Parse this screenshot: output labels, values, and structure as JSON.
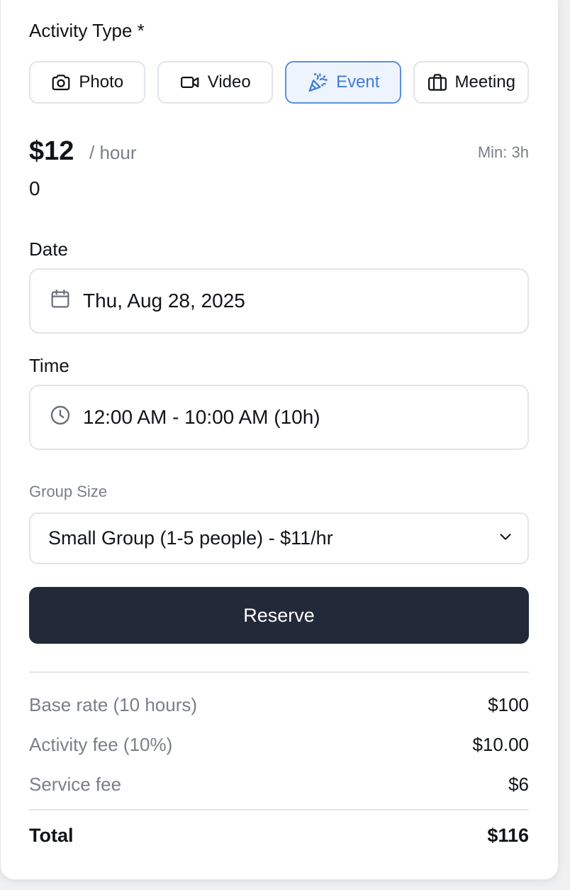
{
  "activity": {
    "label": "Activity Type *",
    "options": [
      {
        "label": "Photo",
        "icon": "camera-icon",
        "selected": false
      },
      {
        "label": "Video",
        "icon": "video-icon",
        "selected": false
      },
      {
        "label": "Event",
        "icon": "party-popper-icon",
        "selected": true
      },
      {
        "label": "Meeting",
        "icon": "briefcase-icon",
        "selected": false
      }
    ],
    "selected_color": "#3f7bd9"
  },
  "pricing": {
    "amount": "$12",
    "unit": "/ hour",
    "minimum": "Min: 3h",
    "extra_line": "0"
  },
  "date": {
    "label": "Date",
    "value": "Thu, Aug 28, 2025",
    "icon": "calendar-icon"
  },
  "time": {
    "label": "Time",
    "value": "12:00 AM - 10:00 AM (10h)",
    "icon": "clock-icon"
  },
  "group": {
    "label": "Group Size",
    "selected": "Small Group (1-5 people) - $11/hr",
    "icon": "chevron-down-icon"
  },
  "reserve": {
    "label": "Reserve",
    "color": "#222938"
  },
  "breakdown": {
    "rows": [
      {
        "label": "Base rate (10 hours)",
        "value": "$100"
      },
      {
        "label": "Activity fee (10%)",
        "value": "$10.00"
      },
      {
        "label": "Service fee",
        "value": "$6"
      }
    ],
    "total_label": "Total",
    "total_value": "$116"
  }
}
